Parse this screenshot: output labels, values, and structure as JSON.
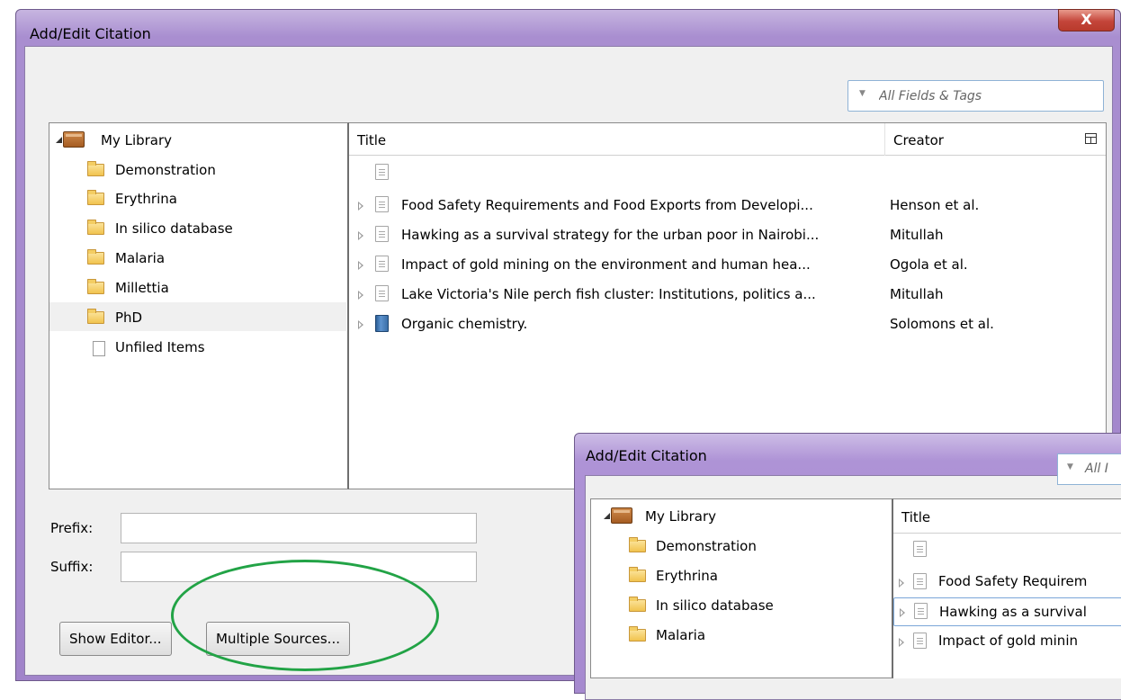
{
  "dialog": {
    "title": "Add/Edit Citation",
    "close_label": "X",
    "search": {
      "placeholder": "All Fields & Tags"
    },
    "collections": [
      {
        "label": "My Library",
        "icon": "library-icon"
      },
      {
        "label": "Demonstration",
        "icon": "folder-icon"
      },
      {
        "label": "Erythrina",
        "icon": "folder-icon"
      },
      {
        "label": "In silico database",
        "icon": "folder-icon"
      },
      {
        "label": "Malaria",
        "icon": "folder-icon"
      },
      {
        "label": "Millettia",
        "icon": "folder-icon"
      },
      {
        "label": "PhD",
        "icon": "folder-icon",
        "selected": true
      },
      {
        "label": "Unfiled Items",
        "icon": "unfiled-icon"
      }
    ],
    "columns": {
      "title": "Title",
      "creator": "Creator"
    },
    "items": [
      {
        "title": "",
        "creator": "",
        "icon": "document-icon"
      },
      {
        "title": "Food Safety Requirements and Food Exports from Developi...",
        "creator": "Henson et al.",
        "icon": "document-icon"
      },
      {
        "title": "Hawking as a survival strategy for the urban poor in Nairobi...",
        "creator": "Mitullah",
        "icon": "document-icon"
      },
      {
        "title": "Impact of gold mining on the environment and human hea...",
        "creator": "Ogola et al.",
        "icon": "document-icon"
      },
      {
        "title": "Lake Victoria's Nile perch fish cluster: Institutions, politics a...",
        "creator": "Mitullah",
        "icon": "document-icon"
      },
      {
        "title": "Organic chemistry.",
        "creator": "Solomons et al.",
        "icon": "book-icon"
      }
    ],
    "prefix_label": "Prefix:",
    "suffix_label": "Suffix:",
    "prefix_value": "",
    "suffix_value": "",
    "show_editor_label": "Show Editor...",
    "multiple_sources_label": "Multiple Sources..."
  },
  "dialog2": {
    "title": "Add/Edit Citation",
    "search_placeholder": "All I",
    "collections": [
      {
        "label": "My Library"
      },
      {
        "label": "Demonstration"
      },
      {
        "label": "Erythrina"
      },
      {
        "label": "In silico database"
      },
      {
        "label": "Malaria"
      }
    ],
    "title_column": "Title",
    "items": [
      {
        "title": ""
      },
      {
        "title": "Food Safety Requirem"
      },
      {
        "title": "Hawking as a survival"
      },
      {
        "title": "Impact of gold minin"
      }
    ]
  },
  "annotation": {
    "color": "#22a346",
    "target": "multiple-sources-button"
  }
}
